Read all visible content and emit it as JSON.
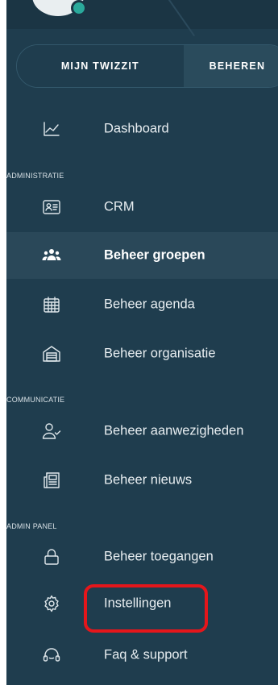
{
  "tabs": {
    "first": "MIJN TWIZZIT",
    "second": "BEHEREN"
  },
  "sections": {
    "administratie": "ADMINISTRATIE",
    "communicatie": "COMMUNICATIE",
    "admin_panel": "ADMIN PANEL"
  },
  "menu": {
    "dashboard": "Dashboard",
    "crm": "CRM",
    "groepen": "Beheer groepen",
    "agenda": "Beheer agenda",
    "organisatie": "Beheer organisatie",
    "aanwezigheden": "Beheer aanwezigheden",
    "nieuws": "Beheer nieuws",
    "toegangen": "Beheer toegangen",
    "instellingen": "Instellingen",
    "faq": "Faq & support"
  },
  "colors": {
    "sidebar_bg": "#1f3d4e",
    "active_bg": "#2a4859",
    "highlight": "#e5161b",
    "accent": "#2aa99b"
  }
}
